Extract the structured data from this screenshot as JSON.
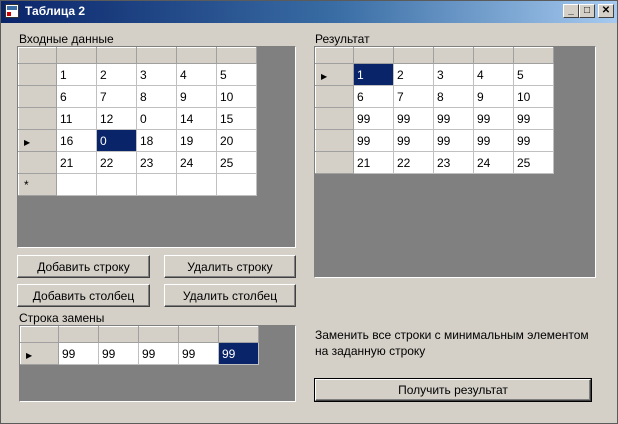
{
  "window": {
    "title": "Таблица 2"
  },
  "input": {
    "label": "Входные данные",
    "rows": [
      [
        "1",
        "2",
        "3",
        "4",
        "5"
      ],
      [
        "6",
        "7",
        "8",
        "9",
        "10"
      ],
      [
        "11",
        "12",
        "0",
        "14",
        "15"
      ],
      [
        "16",
        "0",
        "18",
        "19",
        "20"
      ],
      [
        "21",
        "22",
        "23",
        "24",
        "25"
      ]
    ],
    "current_row": 3,
    "selected_cell": [
      3,
      1
    ]
  },
  "result": {
    "label": "Результат",
    "rows": [
      [
        "1",
        "2",
        "3",
        "4",
        "5"
      ],
      [
        "6",
        "7",
        "8",
        "9",
        "10"
      ],
      [
        "99",
        "99",
        "99",
        "99",
        "99"
      ],
      [
        "99",
        "99",
        "99",
        "99",
        "99"
      ],
      [
        "21",
        "22",
        "23",
        "24",
        "25"
      ]
    ],
    "current_row": 0,
    "selected_cell": [
      0,
      0
    ]
  },
  "replacement": {
    "label": "Строка замены",
    "row": [
      "99",
      "99",
      "99",
      "99",
      "99"
    ],
    "selected_index": 4
  },
  "buttons": {
    "add_row": "Добавить строку",
    "delete_row": "Удалить строку",
    "add_column": "Добавить столбец",
    "delete_column": "Удалить столбец",
    "get_result": "Получить результат"
  },
  "task_description": "Заменить все строки с минимальным элементом на заданную строку",
  "icons": {
    "current_row": "row-pointer-icon",
    "new_row": "asterisk-icon"
  }
}
